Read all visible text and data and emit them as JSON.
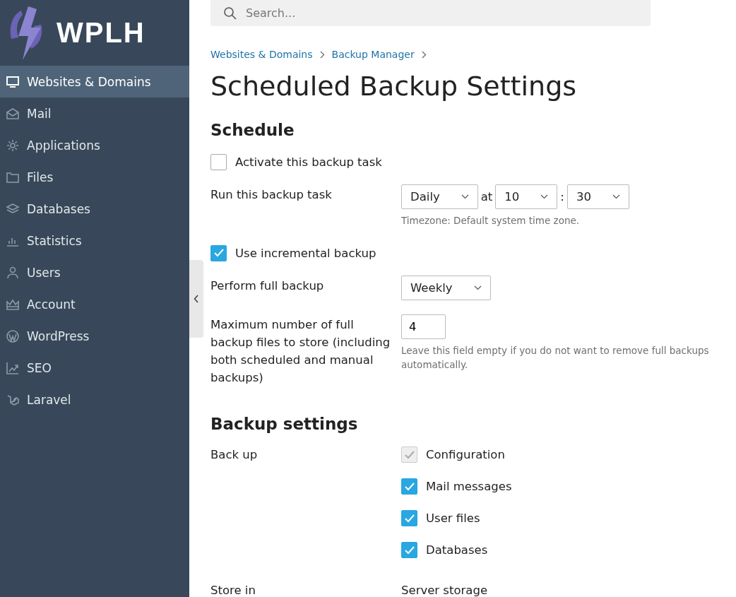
{
  "logo": {
    "text": "WPLH"
  },
  "sidebar": {
    "items": [
      {
        "label": "Websites & Domains",
        "selected": true
      },
      {
        "label": "Mail",
        "selected": false
      },
      {
        "label": "Applications",
        "selected": false
      },
      {
        "label": "Files",
        "selected": false
      },
      {
        "label": "Databases",
        "selected": false
      },
      {
        "label": "Statistics",
        "selected": false
      },
      {
        "label": "Users",
        "selected": false
      },
      {
        "label": "Account",
        "selected": false
      },
      {
        "label": "WordPress",
        "selected": false
      },
      {
        "label": "SEO",
        "selected": false
      },
      {
        "label": "Laravel",
        "selected": false
      }
    ]
  },
  "search": {
    "placeholder": "Search..."
  },
  "breadcrumbs": [
    "Websites & Domains",
    "Backup Manager"
  ],
  "title": "Scheduled Backup Settings",
  "sections": [
    {
      "heading": "Schedule",
      "rows": [
        {
          "kind": "checkbox",
          "label": "Activate this backup task",
          "checked": false
        },
        {
          "kind": "field",
          "label": "Run this backup task",
          "controls": [
            {
              "kind": "select",
              "value": "Daily"
            },
            {
              "kind": "text",
              "text": "at"
            },
            {
              "kind": "select",
              "value": "10"
            },
            {
              "kind": "text",
              "text": ":"
            },
            {
              "kind": "select",
              "value": "30"
            }
          ],
          "hint": "Timezone: Default system time zone."
        },
        {
          "kind": "checkbox",
          "label": "Use incremental backup",
          "checked": true
        },
        {
          "kind": "field",
          "label": "Perform full backup",
          "controls": [
            {
              "kind": "select",
              "value": "Weekly"
            }
          ]
        },
        {
          "kind": "field",
          "label": "Maximum number of full backup files to store (including both scheduled and manual backups)",
          "controls": [
            {
              "kind": "input",
              "value": "4"
            }
          ],
          "hint": "Leave this field empty if you do not want to remove full backups automatically."
        }
      ]
    },
    {
      "heading": "Backup settings",
      "rows": [
        {
          "kind": "checklist",
          "label": "Back up",
          "items": [
            {
              "label": "Configuration",
              "checked": true,
              "disabled": true
            },
            {
              "label": "Mail messages",
              "checked": true,
              "disabled": false
            },
            {
              "label": "User files",
              "checked": true,
              "disabled": false
            },
            {
              "label": "Databases",
              "checked": true,
              "disabled": false
            }
          ]
        },
        {
          "kind": "static",
          "label": "Store in",
          "value": "Server storage"
        }
      ]
    }
  ]
}
